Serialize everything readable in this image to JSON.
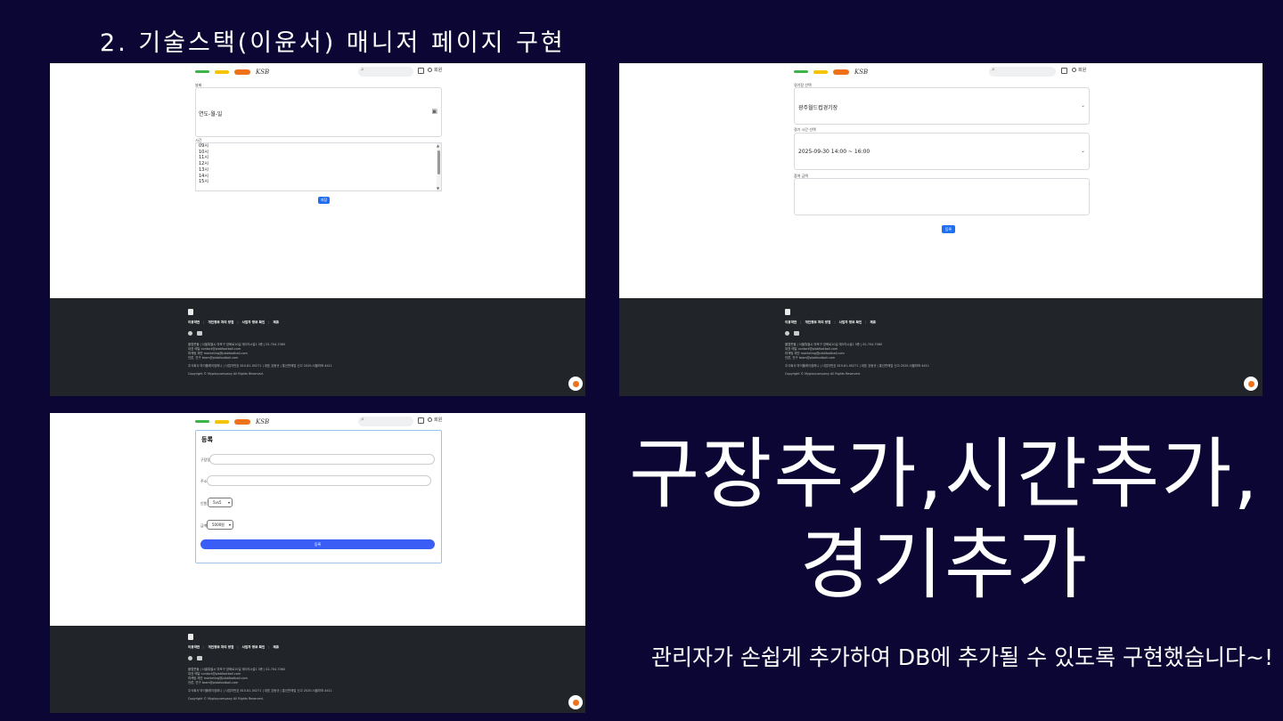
{
  "slide": {
    "title": "2. 기술스택(이윤서) 매니저 페이지 구현",
    "headline": "구장추가,시간추가,경기추가",
    "description": "관리자가 손쉽게  추가하여 DB에 추가될 수 있도록 구현했습니다~!"
  },
  "header": {
    "logo_text": "KSB",
    "user_label": "회원"
  },
  "screen_time": {
    "date_label": "날짜",
    "date_placeholder": "연도-월-일",
    "time_label": "시간",
    "time_options": [
      "09시",
      "10시",
      "11시",
      "12시",
      "13시",
      "14시",
      "15시"
    ],
    "save_label": "저장"
  },
  "screen_match": {
    "stadium_label": "경기장 선택",
    "stadium_value": "광주월드컵경기장",
    "time_label": "경기 시간 선택",
    "time_value": "2025-09-30 14:00 ~ 16:00",
    "price_label": "참여 금액",
    "submit_label": "등록"
  },
  "screen_stadium": {
    "card_title": "등록",
    "name_label": "구장명",
    "address_label": "주소",
    "type_label": "인원",
    "type_value": "5vs5",
    "price_label": "금액",
    "price_value": "5000원",
    "submit_label": "등록"
  },
  "footer": {
    "links": [
      "이용약관",
      "개인정보 처리 방침",
      "사업자 정보 확인",
      "제휴"
    ],
    "lines": [
      "플랩풋볼 | 서울특별시 마포구 양화로10길 제5차시설1 3층 | 02-704-7060",
      "대표 메일 contact@plabfootball.com",
      "마케팅 제안 marketing@plabfootball.com",
      "언론, 연구 team@plabfootball.com"
    ],
    "company_line": "주식회사 마이플레이컴퍼니 | 사업자번호 810-81-00271 | 대표 강동규 | 통신판매업 신고 2020-서울마포-4411",
    "copyright": "Copyright © Myplaycompany All Rights Reserved."
  },
  "colors": {
    "background": "#0c0634",
    "primary_button": "#1f6ff2",
    "footer": "#212529"
  }
}
